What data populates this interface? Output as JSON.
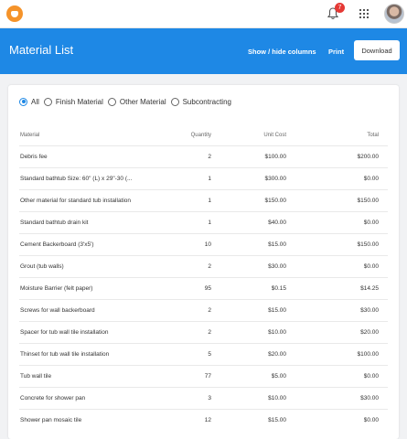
{
  "topbar": {
    "notification_count": "7"
  },
  "header": {
    "title": "Material List",
    "show_hide_label": "Show / hide columns",
    "print_label": "Print",
    "download_label": "Download"
  },
  "filters": [
    {
      "label": "All",
      "selected": true
    },
    {
      "label": "Finish Material",
      "selected": false
    },
    {
      "label": "Other Material",
      "selected": false
    },
    {
      "label": "Subcontracting",
      "selected": false
    }
  ],
  "table": {
    "columns": {
      "material": "Material",
      "quantity": "Quantity",
      "unit_cost": "Unit Cost",
      "total": "Total"
    },
    "rows": [
      {
        "material": "Debris fee",
        "quantity": "2",
        "unit_cost": "$100.00",
        "total": "$200.00"
      },
      {
        "material": "Standard bathtub Size: 60\" (L) x 29\"-30 (...",
        "quantity": "1",
        "unit_cost": "$300.00",
        "total": "$0.00"
      },
      {
        "material": "Other material for standard tub installation",
        "quantity": "1",
        "unit_cost": "$150.00",
        "total": "$150.00"
      },
      {
        "material": "Standard bathtub drain kit",
        "quantity": "1",
        "unit_cost": "$40.00",
        "total": "$0.00"
      },
      {
        "material": "Cement Backerboard (3'x5')",
        "quantity": "10",
        "unit_cost": "$15.00",
        "total": "$150.00"
      },
      {
        "material": "Grout (tub walls)",
        "quantity": "2",
        "unit_cost": "$30.00",
        "total": "$0.00"
      },
      {
        "material": "Moisture Barrier (felt paper)",
        "quantity": "95",
        "unit_cost": "$0.15",
        "total": "$14.25"
      },
      {
        "material": "Screws for wall backerboard",
        "quantity": "2",
        "unit_cost": "$15.00",
        "total": "$30.00"
      },
      {
        "material": "Spacer for tub wall tile installation",
        "quantity": "2",
        "unit_cost": "$10.00",
        "total": "$20.00"
      },
      {
        "material": "Thinset for tub wall tile installation",
        "quantity": "5",
        "unit_cost": "$20.00",
        "total": "$100.00"
      },
      {
        "material": "Tub wall tile",
        "quantity": "77",
        "unit_cost": "$5.00",
        "total": "$0.00"
      },
      {
        "material": "Concrete for shower pan",
        "quantity": "3",
        "unit_cost": "$10.00",
        "total": "$30.00"
      },
      {
        "material": "Shower pan mosaic tile",
        "quantity": "12",
        "unit_cost": "$15.00",
        "total": "$0.00"
      }
    ]
  },
  "icons": {
    "logo": "logo-icon",
    "bell": "bell-icon",
    "apps": "apps-grid-icon",
    "avatar": "user-avatar"
  },
  "colors": {
    "primary": "#1e88e5",
    "badge": "#e53935",
    "logo": "#f5932a"
  }
}
